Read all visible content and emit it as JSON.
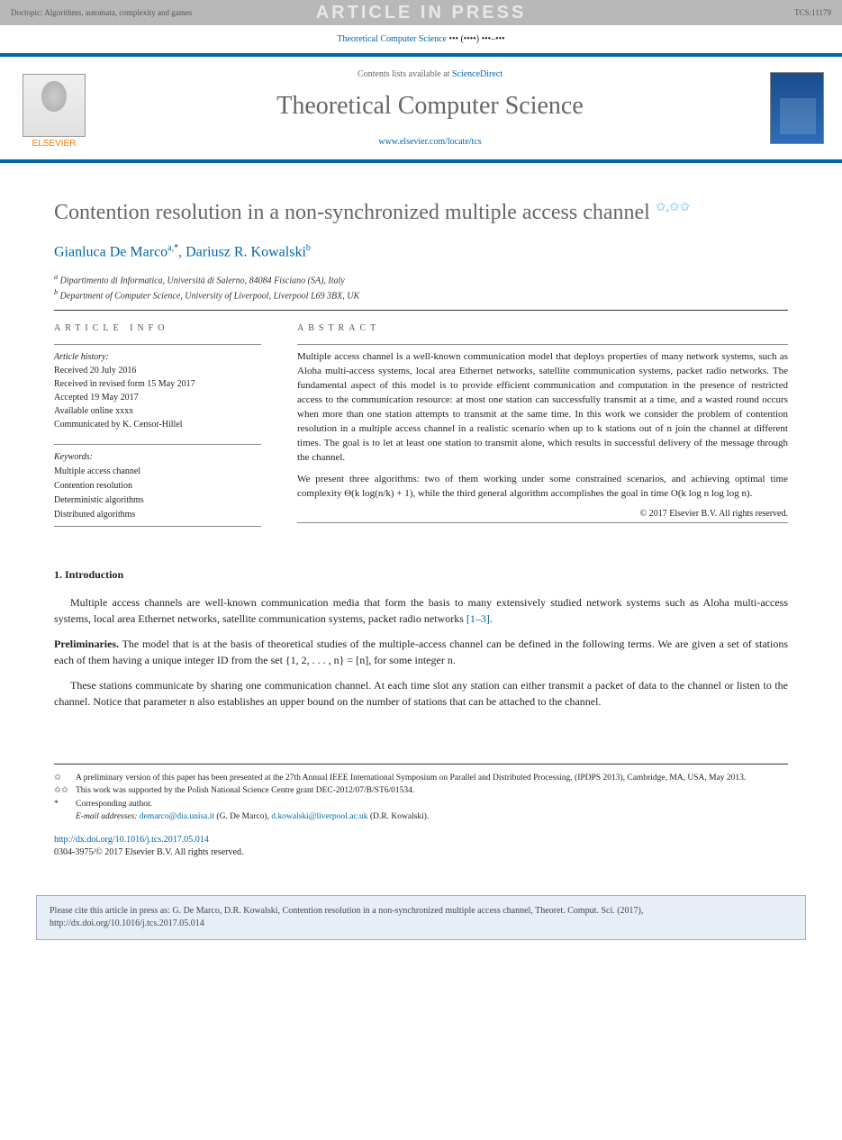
{
  "banner": {
    "doctopic": "Doctopic: Algorithms, automata, complexity and games",
    "watermark": "ARTICLE IN PRESS",
    "id_label": "TCS:11179"
  },
  "citation_line": {
    "prefix": "Theoretical Computer Science",
    "suffix": " ••• (••••) •••–•••"
  },
  "journal_header": {
    "elsevier": "ELSEVIER",
    "contents_prefix": "Contents lists available at ",
    "contents_link": "ScienceDirect",
    "title": "Theoretical Computer Science",
    "locate_link": "www.elsevier.com/locate/tcs",
    "cover_label": "Theoretical Computer Science"
  },
  "article": {
    "title": "Contention resolution in a non-synchronized multiple access channel",
    "stars": "✩,✩✩"
  },
  "authors": {
    "a1_name": "Gianluca De Marco",
    "a1_sup": "a,",
    "a1_star": "*",
    "sep": ", ",
    "a2_name": "Dariusz R. Kowalski",
    "a2_sup": "b"
  },
  "affiliations": {
    "a": "Dipartimento di Informatica, Università di Salerno, 84084 Fisciano (SA), Italy",
    "b": "Department of Computer Science, University of Liverpool, Liverpool L69 3BX, UK"
  },
  "info": {
    "label": "ARTICLE INFO",
    "history_label": "Article history:",
    "received": "Received 20 July 2016",
    "revised": "Received in revised form 15 May 2017",
    "accepted": "Accepted 19 May 2017",
    "online": "Available online xxxx",
    "communicated": "Communicated by K. Censor-Hillel",
    "keywords_label": "Keywords:",
    "kw1": "Multiple access channel",
    "kw2": "Contention resolution",
    "kw3": "Deterministic algorithms",
    "kw4": "Distributed algorithms"
  },
  "abstract": {
    "label": "ABSTRACT",
    "p1": "Multiple access channel is a well-known communication model that deploys properties of many network systems, such as Aloha multi-access systems, local area Ethernet networks, satellite communication systems, packet radio networks. The fundamental aspect of this model is to provide efficient communication and computation in the presence of restricted access to the communication resource: at most one station can successfully transmit at a time, and a wasted round occurs when more than one station attempts to transmit at the same time. In this work we consider the problem of contention resolution in a multiple access channel in a realistic scenario when up to k stations out of n join the channel at different times. The goal is to let at least one station to transmit alone, which results in successful delivery of the message through the channel.",
    "p2": "We present three algorithms: two of them working under some constrained scenarios, and achieving optimal time complexity Θ(k log(n/k) + 1), while the third general algorithm accomplishes the goal in time O(k log n log log n).",
    "copyright": "© 2017 Elsevier B.V. All rights reserved."
  },
  "intro": {
    "heading": "1. Introduction",
    "p1_a": "Multiple access channels are well-known communication media that form the basis to many extensively studied network systems such as Aloha multi-access systems, local area Ethernet networks, satellite communication systems, packet radio networks ",
    "p1_ref": "[1–3]",
    "p1_b": ".",
    "prelim_label": "Preliminaries.",
    "prelim_text": " The model that is at the basis of theoretical studies of the multiple-access channel can be defined in the following terms. We are given a set of stations each of them having a unique integer ID from the set {1, 2, . . . , n} = [n], for some integer n.",
    "p2": "These stations communicate by sharing one communication channel. At each time slot any station can either transmit a packet of data to the channel or listen to the channel. Notice that parameter n also establishes an upper bound on the number of stations that can be attached to the channel."
  },
  "footnotes": {
    "n1": "A preliminary version of this paper has been presented at the 27th Annual IEEE International Symposium on Parallel and Distributed Processing, (IPDPS 2013), Cambridge, MA, USA, May 2013.",
    "n2": "This work was supported by the Polish National Science Centre grant DEC-2012/07/B/ST6/01534.",
    "corr": "Corresponding author.",
    "email_label": "E-mail addresses: ",
    "email1": "demarco@dia.unisa.it",
    "email1_who": " (G. De Marco), ",
    "email2": "d.kowalski@liverpool.ac.uk",
    "email2_who": " (D.R. Kowalski)."
  },
  "doi": {
    "link": "http://dx.doi.org/10.1016/j.tcs.2017.05.014",
    "line2": "0304-3975/© 2017 Elsevier B.V. All rights reserved."
  },
  "cite_box": {
    "text": "Please cite this article in press as: G. De Marco, D.R. Kowalski, Contention resolution in a non-synchronized multiple access channel, Theoret. Comput. Sci. (2017), http://dx.doi.org/10.1016/j.tcs.2017.05.014"
  }
}
